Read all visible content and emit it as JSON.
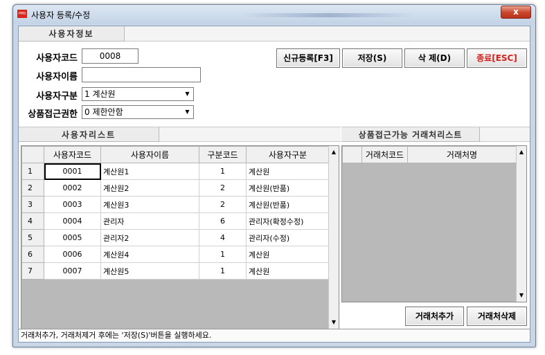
{
  "window": {
    "icon_text": "PMS",
    "title": "사용자 등록/수정",
    "close_label": "x"
  },
  "user_info": {
    "tab": "사용자정보",
    "code_label": "사용자코드",
    "code_value": "0008",
    "name_label": "사용자이름",
    "name_value": "",
    "type_label": "사용자구분",
    "type_value": "1 계산원",
    "access_label": "상품접근권한",
    "access_value": "0 제한안함"
  },
  "buttons": {
    "new": "신규등록[F3]",
    "save": "저장(S)",
    "delete": "삭 제(D)",
    "close": "종료[ESC]",
    "add_vendor": "거래처추가",
    "delete_vendor": "거래처삭제"
  },
  "user_list": {
    "tab": "사용자리스트",
    "columns": [
      "",
      "사용자코드",
      "사용자이름",
      "구분코드",
      "사용자구분"
    ],
    "rows": [
      [
        "1",
        "0001",
        "계산원1",
        "1",
        "계산원"
      ],
      [
        "2",
        "0002",
        "계산원2",
        "2",
        "계산원(반품)"
      ],
      [
        "3",
        "0003",
        "계산원3",
        "2",
        "계산원(반품)"
      ],
      [
        "4",
        "0004",
        "관리자",
        "6",
        "관리자(확정수정)"
      ],
      [
        "5",
        "0005",
        "관리자2",
        "4",
        "관리자(수정)"
      ],
      [
        "6",
        "0006",
        "계산원4",
        "1",
        "계산원"
      ],
      [
        "7",
        "0007",
        "계산원5",
        "1",
        "계산원"
      ]
    ]
  },
  "vendor_list": {
    "tab": "상품접근가능 거래처리스트",
    "columns": [
      "",
      "거래처코드",
      "거래처명"
    ]
  },
  "status_text": "거래처추가, 거래처제거 후에는 '저장(S)'버튼을 실행하세요.",
  "icons": {
    "dropdown": "chevron-down-icon",
    "scroll_up": "scroll-up-icon",
    "scroll_down": "scroll-down-icon"
  }
}
